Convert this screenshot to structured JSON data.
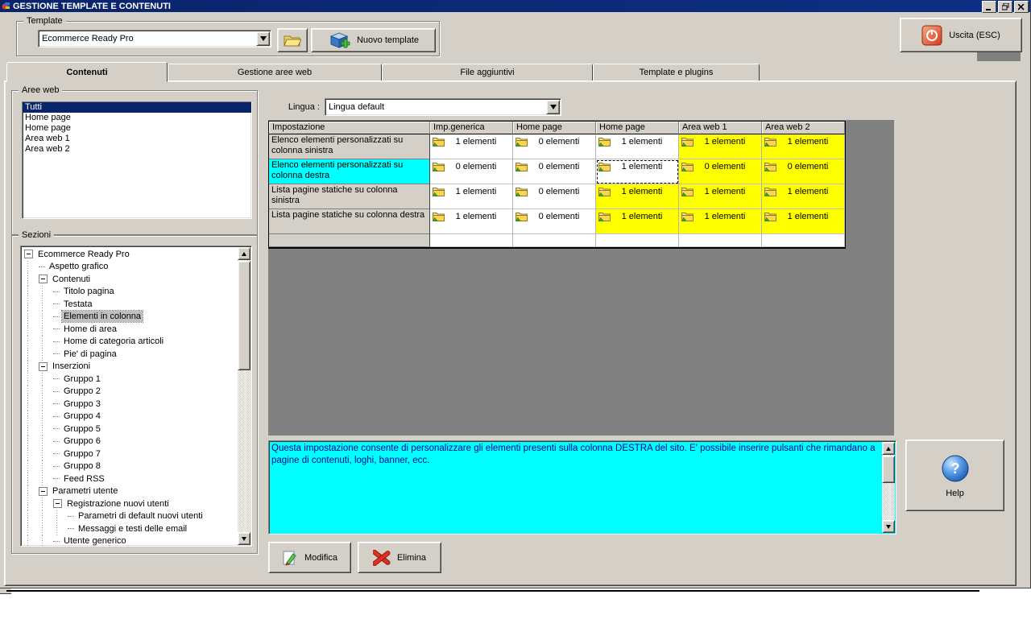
{
  "window": {
    "title": "GESTIONE TEMPLATE E CONTENUTI",
    "controls": [
      "minimize",
      "restore",
      "close"
    ]
  },
  "template_box": {
    "label": "Template",
    "combo_value": "Ecommerce Ready Pro",
    "browse_icon": "open-folder-icon",
    "new_template_label": "Nuovo template"
  },
  "exit_button": {
    "label": "Uscita (ESC)",
    "icon": "power-icon"
  },
  "tabs": [
    {
      "label": "Contenuti",
      "active": true
    },
    {
      "label": "Gestione aree web",
      "active": false
    },
    {
      "label": "File aggiuntivi",
      "active": false
    },
    {
      "label": "Template e plugins",
      "active": false
    }
  ],
  "aree_web": {
    "label": "Aree web",
    "items": [
      "Tutti",
      "Home page",
      "Home page",
      "Area web 1",
      "Area web 2"
    ],
    "selected_index": 0
  },
  "sezioni": {
    "label": "Sezioni",
    "tree": [
      {
        "text": "Ecommerce Ready Pro",
        "depth": 0,
        "expandable": true,
        "selected": false
      },
      {
        "text": "Aspetto grafico",
        "depth": 1,
        "expandable": false,
        "selected": false
      },
      {
        "text": "Contenuti",
        "depth": 1,
        "expandable": true,
        "selected": false
      },
      {
        "text": "Titolo pagina",
        "depth": 2,
        "expandable": false,
        "selected": false
      },
      {
        "text": "Testata",
        "depth": 2,
        "expandable": false,
        "selected": false
      },
      {
        "text": "Elementi in colonna",
        "depth": 2,
        "expandable": false,
        "selected": true
      },
      {
        "text": "Home di area",
        "depth": 2,
        "expandable": false,
        "selected": false
      },
      {
        "text": "Home di categoria articoli",
        "depth": 2,
        "expandable": false,
        "selected": false
      },
      {
        "text": "Pie' di pagina",
        "depth": 2,
        "expandable": false,
        "selected": false
      },
      {
        "text": "Inserzioni",
        "depth": 1,
        "expandable": true,
        "selected": false
      },
      {
        "text": "Gruppo 1",
        "depth": 2,
        "expandable": false,
        "selected": false
      },
      {
        "text": "Gruppo 2",
        "depth": 2,
        "expandable": false,
        "selected": false
      },
      {
        "text": "Gruppo 3",
        "depth": 2,
        "expandable": false,
        "selected": false
      },
      {
        "text": "Gruppo 4",
        "depth": 2,
        "expandable": false,
        "selected": false
      },
      {
        "text": "Gruppo 5",
        "depth": 2,
        "expandable": false,
        "selected": false
      },
      {
        "text": "Gruppo 6",
        "depth": 2,
        "expandable": false,
        "selected": false
      },
      {
        "text": "Gruppo 7",
        "depth": 2,
        "expandable": false,
        "selected": false
      },
      {
        "text": "Gruppo 8",
        "depth": 2,
        "expandable": false,
        "selected": false
      },
      {
        "text": "Feed RSS",
        "depth": 2,
        "expandable": false,
        "selected": false
      },
      {
        "text": "Parametri utente",
        "depth": 1,
        "expandable": true,
        "selected": false
      },
      {
        "text": "Registrazione nuovi utenti",
        "depth": 2,
        "expandable": true,
        "selected": false
      },
      {
        "text": "Parametri di default nuovi utenti",
        "depth": 3,
        "expandable": false,
        "selected": false
      },
      {
        "text": "Messaggi e testi delle email",
        "depth": 3,
        "expandable": false,
        "selected": false
      },
      {
        "text": "Utente generico",
        "depth": 2,
        "expandable": false,
        "selected": false
      }
    ]
  },
  "lingua": {
    "label": "Lingua :",
    "value": "Lingua default"
  },
  "grid": {
    "cell_icon": "folder-icon",
    "columns": [
      "Impostazione",
      "Imp.generica",
      "Home page",
      "Home page",
      "Area web 1",
      "Area web 2"
    ],
    "rows": [
      {
        "label": "Elenco elementi personalizzati su colonna sinistra",
        "label_bg": "gray",
        "cells": [
          {
            "text": "1 elementi",
            "bg": "white",
            "focused": false
          },
          {
            "text": "0 elementi",
            "bg": "white",
            "focused": false
          },
          {
            "text": "1 elementi",
            "bg": "white",
            "focused": false
          },
          {
            "text": "1 elementi",
            "bg": "yellow",
            "focused": false
          },
          {
            "text": "1 elementi",
            "bg": "yellow",
            "focused": false
          }
        ]
      },
      {
        "label": "Elenco elementi personalizzati su colonna destra",
        "label_bg": "cyan",
        "cells": [
          {
            "text": "0 elementi",
            "bg": "white",
            "focused": false
          },
          {
            "text": "0 elementi",
            "bg": "white",
            "focused": false
          },
          {
            "text": "1 elementi",
            "bg": "white",
            "focused": true
          },
          {
            "text": "0 elementi",
            "bg": "yellow",
            "focused": false
          },
          {
            "text": "0 elementi",
            "bg": "yellow",
            "focused": false
          }
        ]
      },
      {
        "label": "Lista pagine statiche su colonna sinistra",
        "label_bg": "gray",
        "cells": [
          {
            "text": "1 elementi",
            "bg": "white",
            "focused": false
          },
          {
            "text": "0 elementi",
            "bg": "white",
            "focused": false
          },
          {
            "text": "1 elementi",
            "bg": "yellow",
            "focused": false
          },
          {
            "text": "1 elementi",
            "bg": "yellow",
            "focused": false
          },
          {
            "text": "1 elementi",
            "bg": "yellow",
            "focused": false
          }
        ]
      },
      {
        "label": "Lista pagine statiche su colonna destra",
        "label_bg": "gray",
        "cells": [
          {
            "text": "1 elementi",
            "bg": "white",
            "focused": false
          },
          {
            "text": "0 elementi",
            "bg": "white",
            "focused": false
          },
          {
            "text": "1 elementi",
            "bg": "yellow",
            "focused": false
          },
          {
            "text": "1 elementi",
            "bg": "yellow",
            "focused": false
          },
          {
            "text": "1 elementi",
            "bg": "yellow",
            "focused": false
          }
        ]
      }
    ]
  },
  "description": {
    "text": "Questa impostazione consente di personalizzare gli elementi presenti sulla colonna DESTRA del sito. E' possibile inserire pulsanti che rimandano a pagine di contenuti, loghi, banner, ecc."
  },
  "help_button": {
    "label": "Help",
    "icon": "question-icon"
  },
  "actions": {
    "modifica": "Modifica",
    "elimina": "Elimina"
  },
  "colors": {
    "titlebar": "#0a246a",
    "window_bg": "#d4d0c8",
    "grid_backdrop": "#808080",
    "highlight_yellow": "#ffff00",
    "highlight_cyan": "#00ffff",
    "selection_navy": "#0a246a",
    "info_text": "#0000a0"
  }
}
